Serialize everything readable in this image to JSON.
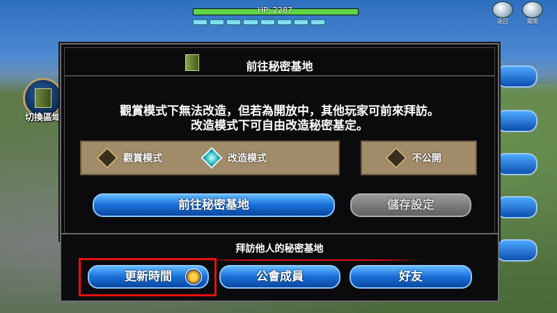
{
  "hud": {
    "hp_text": "HP: 2287",
    "hp_fill_fraction": 1.0,
    "mp_segments": 8,
    "return_label": "返回",
    "close_label": "關閉"
  },
  "left": {
    "switch_label": "切換區域"
  },
  "panel": {
    "title": "前往秘密基地",
    "description_line1": "觀賞模式下無法改造，但若為開放中，其他玩家可前來拜訪。",
    "description_line2": "改造模式下可自由改造秘密基定。",
    "options": {
      "view_mode": "觀賞模式",
      "edit_mode": "改造模式",
      "private": "不公開"
    },
    "go_button": "前往秘密基地",
    "save_button": "儲存設定"
  },
  "visit": {
    "title": "拜訪他人的秘密基地",
    "update_time": "更新時間",
    "guild_members": "公會成員",
    "friends": "好友"
  },
  "colors": {
    "accent_blue": "#1a6fd8",
    "highlight_red": "#e81010"
  }
}
